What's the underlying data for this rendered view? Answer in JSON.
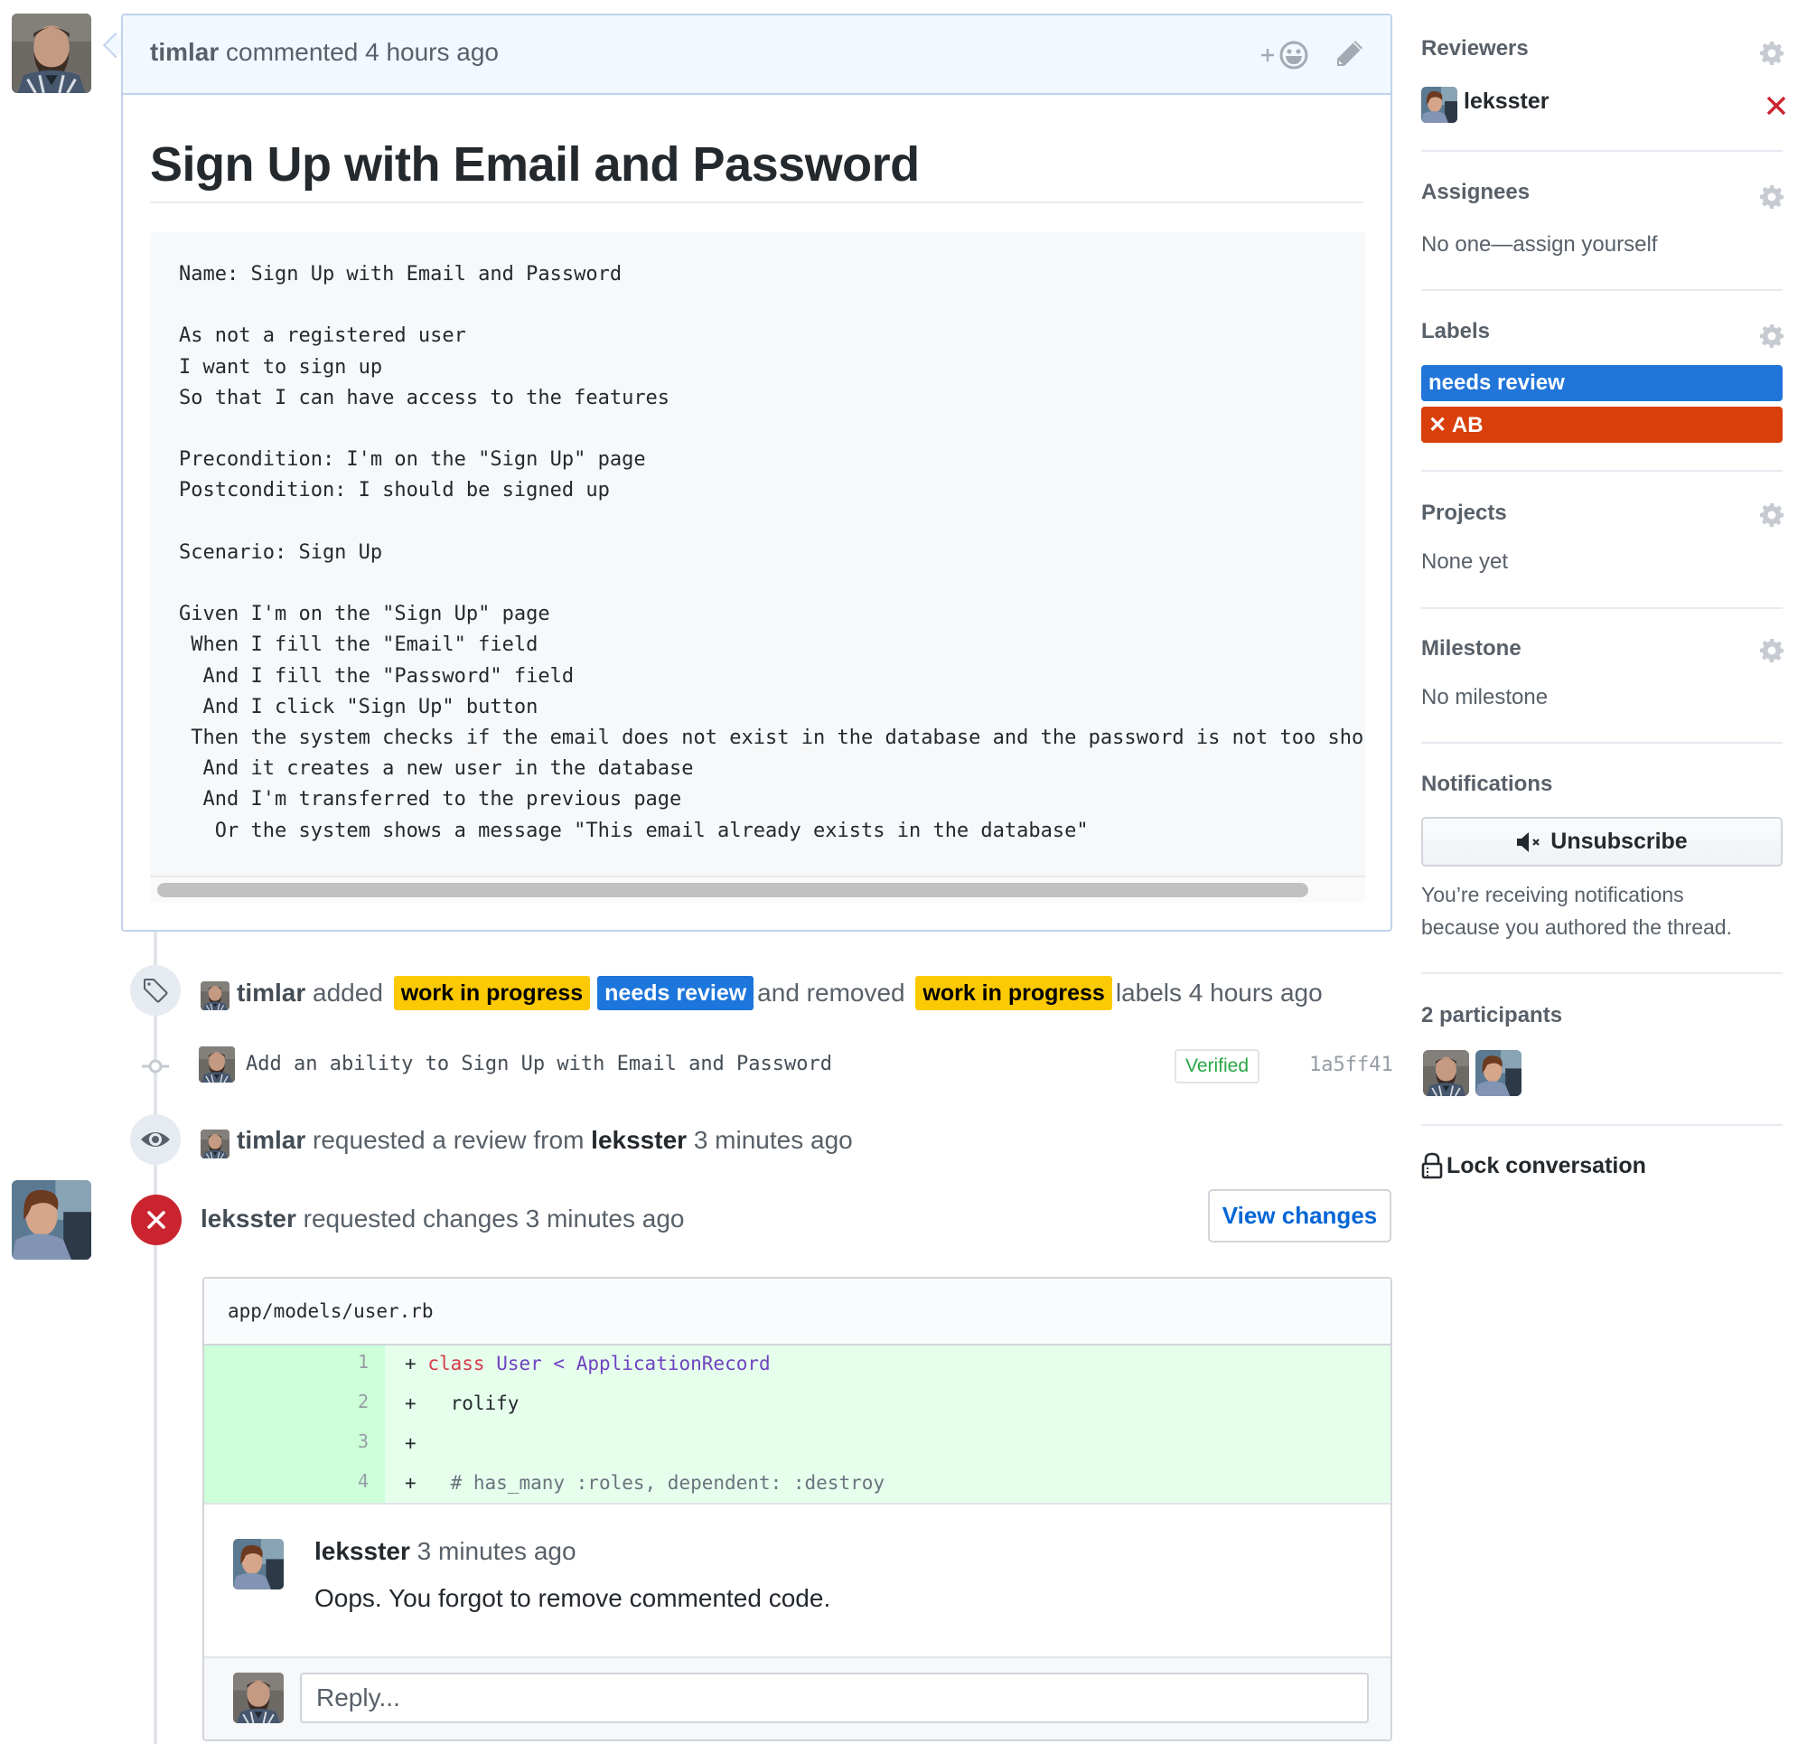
{
  "comment": {
    "author": "timlar",
    "action": "commented",
    "time": "4 hours ago",
    "reaction_plus": "+",
    "title": "Sign Up with Email and Password",
    "code_lines": [
      "Name: Sign Up with Email and Password",
      "",
      "As not a registered user",
      "I want to sign up",
      "So that I can have access to the features",
      "",
      "Precondition: I'm on the \"Sign Up\" page",
      "Postcondition: I should be signed up",
      "",
      "Scenario: Sign Up",
      "",
      "Given I'm on the \"Sign Up\" page",
      " When I fill the \"Email\" field",
      "  And I fill the \"Password\" field",
      "  And I click \"Sign Up\" button",
      " Then the system checks if the email does not exist in the database and the password is not too sho",
      "  And it creates a new user in the database",
      "  And I'm transferred to the previous page",
      "   Or the system shows a message \"This email already exists in the database\""
    ]
  },
  "timeline": {
    "label_event": {
      "author": "timlar",
      "added_word": "added",
      "added_labels": [
        {
          "name": "work in progress",
          "bg": "#fbca04",
          "fg": "#000000"
        },
        {
          "name": "needs review",
          "bg": "#1d76db",
          "fg": "#ffffff"
        }
      ],
      "removed_word": "and removed",
      "removed_labels": [
        {
          "name": "work in progress",
          "bg": "#fbca04",
          "fg": "#000000"
        }
      ],
      "suffix": "labels 4 hours ago"
    },
    "commit_event": {
      "message": "Add an ability to Sign Up with Email and Password",
      "verified": "Verified",
      "sha": "1a5ff41"
    },
    "review_request_event": {
      "author": "timlar",
      "text": "requested a review from",
      "reviewer": "leksster",
      "time": "3 minutes ago"
    },
    "changes_requested_event": {
      "author": "leksster",
      "text": "requested changes 3 minutes ago",
      "view_changes": "View changes"
    }
  },
  "review": {
    "file_path": "app/models/user.rb",
    "diff_lines": [
      {
        "num": "1",
        "sign": "+",
        "tokens": [
          {
            "t": " ",
            "c": ""
          },
          {
            "t": "class",
            "c": "kw"
          },
          {
            "t": " ",
            "c": ""
          },
          {
            "t": "User",
            "c": "cls"
          },
          {
            "t": " < ",
            "c": "cls"
          },
          {
            "t": "ApplicationRecord",
            "c": "cls"
          }
        ]
      },
      {
        "num": "2",
        "sign": "+",
        "tokens": [
          {
            "t": "   rolify",
            "c": ""
          }
        ]
      },
      {
        "num": "3",
        "sign": "+",
        "tokens": []
      },
      {
        "num": "4",
        "sign": "+",
        "tokens": [
          {
            "t": "   # has_many :roles, dependent: :destroy",
            "c": "cmt"
          }
        ]
      }
    ],
    "comment_author": "leksster",
    "comment_time": "3 minutes ago",
    "comment_body": "Oops. You forgot to remove commented code.",
    "reply_placeholder": "Reply..."
  },
  "sidebar": {
    "reviewers": {
      "heading": "Reviewers",
      "items": [
        {
          "name": "leksster",
          "status": "changes-requested"
        }
      ]
    },
    "assignees": {
      "heading": "Assignees",
      "empty_text": "No one—assign yourself"
    },
    "labels": {
      "heading": "Labels",
      "items": [
        {
          "name": "needs review",
          "bg": "#2175d9",
          "prefix": ""
        },
        {
          "name": "AB",
          "bg": "#d93f0b",
          "prefix": "✕ "
        }
      ]
    },
    "projects": {
      "heading": "Projects",
      "empty_text": "None yet"
    },
    "milestone": {
      "heading": "Milestone",
      "empty_text": "No milestone"
    },
    "notifications": {
      "heading": "Notifications",
      "button_label": "Unsubscribe",
      "reason_line1": "You’re receiving notifications",
      "reason_line2": "because you authored the thread."
    },
    "participants": {
      "heading": "2 participants",
      "count": 2
    },
    "lock_label": "Lock conversation"
  }
}
